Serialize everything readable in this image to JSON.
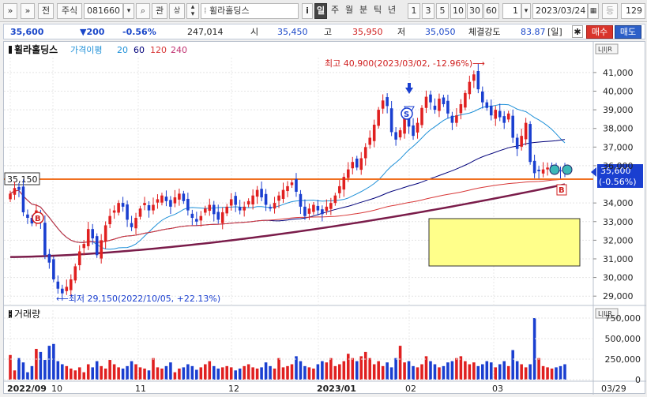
{
  "toolbar": {
    "expand_label": "»",
    "collapse_label": "»",
    "jeon_label": "전",
    "market_label": "주식",
    "code": "081660",
    "gwan_label": "관",
    "name": "휠라홀딩스",
    "info_label": "i",
    "periods": [
      "일",
      "주",
      "월",
      "분",
      "틱",
      "년"
    ],
    "active_period": "일",
    "minutes": [
      "1",
      "3",
      "5",
      "10",
      "30",
      "60"
    ],
    "count_value": "1",
    "date": "2023/03/24",
    "equal_label": "등",
    "bars": "129"
  },
  "quote": {
    "price": "35,600",
    "change": "▼200",
    "change_pct": "-0.56%",
    "volume": "247,014",
    "open_label": "시",
    "open": "35,450",
    "high_label": "고",
    "high": "35,950",
    "low_label": "저",
    "low": "35,050",
    "strength_label": "체결강도",
    "strength": "83.87",
    "period_tag": "[일]",
    "buy_label": "매수",
    "sell_label": "매도"
  },
  "chart": {
    "legend_title": "휠라홀딩스",
    "legend_ma_label": "가격이평",
    "ma_periods": [
      "20",
      "60",
      "120",
      "240"
    ],
    "ma_colors": [
      "#1e90d8",
      "#00007a",
      "#d83838",
      "#7a1c4a"
    ],
    "ohlc_button_label": "L|I|R",
    "hline_label": "35,150",
    "high_annotation": "최고 40,900(2023/03/02, -12.96%)⟶",
    "low_annotation": "⟵최저 29,150(2022/10/05, +22.13%)",
    "current_price_tag": "35,600",
    "current_pct_tag": "(-0.56%)",
    "marker_B": "B",
    "marker_S": "S",
    "volume_title": "거래량",
    "x_ticks": [
      "2022/09",
      "10",
      "11",
      "12",
      "2023/01",
      "02",
      "03",
      "03/29"
    ],
    "y_ticks": [
      "41,000",
      "40,000",
      "39,000",
      "38,000",
      "37,000",
      "36,000",
      "34,000",
      "33,000",
      "32,000",
      "31,000",
      "30,000",
      "29,000"
    ],
    "vol_ticks": [
      "750,000",
      "500,000",
      "250,000",
      "0"
    ]
  },
  "chart_data": {
    "type": "candlestick",
    "title": "휠라홀딩스",
    "y_range": [
      28500,
      41800
    ],
    "hline": 35150,
    "close_series": [
      34500,
      34800,
      34700,
      33500,
      33200,
      32900,
      33600,
      33000,
      31200,
      30800,
      29900,
      29400,
      29150,
      29500,
      29900,
      30600,
      31400,
      31800,
      32600,
      32100,
      31200,
      32000,
      32800,
      33300,
      33600,
      34000,
      33800,
      33100,
      32700,
      33200,
      33700,
      34000,
      33600,
      33900,
      34200,
      34400,
      34100,
      33800,
      34300,
      34500,
      34100,
      33600,
      33200,
      33000,
      33300,
      33700,
      33900,
      33400,
      33100,
      33500,
      33800,
      34200,
      33900,
      33600,
      33800,
      34100,
      34400,
      34700,
      34300,
      33900,
      33700,
      34000,
      34400,
      34700,
      34900,
      35100,
      34600,
      33800,
      33300,
      33700,
      33900,
      33600,
      33400,
      33800,
      34000,
      34400,
      34900,
      35400,
      35800,
      36200,
      35900,
      36400,
      37000,
      37500,
      38200,
      39000,
      39500,
      39200,
      37800,
      37400,
      37900,
      38600,
      38100,
      37600,
      38300,
      39100,
      39700,
      39400,
      39000,
      39600,
      39300,
      38800,
      38300,
      38700,
      39300,
      39900,
      40500,
      40900,
      40100,
      39400,
      39100,
      38700,
      39000,
      38600,
      38300,
      38800,
      37500,
      36900,
      37600,
      38300,
      36200,
      35600,
      35700,
      35800,
      35900,
      36000,
      35800,
      35700,
      35600
    ],
    "volume_series": [
      0.4,
      0.15,
      0.35,
      0.28,
      0.12,
      0.22,
      0.5,
      0.45,
      0.32,
      0.55,
      0.58,
      0.3,
      0.25,
      0.22,
      0.18,
      0.15,
      0.2,
      0.12,
      0.25,
      0.2,
      0.3,
      0.22,
      0.18,
      0.32,
      0.25,
      0.2,
      0.18,
      0.22,
      0.3,
      0.25,
      0.2,
      0.18,
      0.15,
      0.35,
      0.2,
      0.18,
      0.22,
      0.28,
      0.12,
      0.18,
      0.2,
      0.25,
      0.22,
      0.16,
      0.2,
      0.25,
      0.3,
      0.22,
      0.18,
      0.2,
      0.22,
      0.2,
      0.15,
      0.18,
      0.22,
      0.25,
      0.2,
      0.18,
      0.2,
      0.28,
      0.22,
      0.18,
      0.35,
      0.2,
      0.22,
      0.25,
      0.38,
      0.3,
      0.22,
      0.2,
      0.18,
      0.25,
      0.3,
      0.28,
      0.35,
      0.22,
      0.25,
      0.3,
      0.42,
      0.35,
      0.3,
      0.38,
      0.45,
      0.35,
      0.25,
      0.3,
      0.22,
      0.28,
      0.2,
      0.35,
      0.55,
      0.28,
      0.3,
      0.22,
      0.2,
      0.25,
      0.38,
      0.3,
      0.25,
      0.2,
      0.22,
      0.28,
      0.3,
      0.35,
      0.38,
      0.3,
      0.25,
      0.28,
      0.22,
      0.25,
      0.3,
      0.28,
      0.2,
      0.25,
      0.3,
      0.22,
      0.48,
      0.3,
      0.25,
      0.2,
      0.25,
      1.0,
      0.35,
      0.22,
      0.2,
      0.18,
      0.2,
      0.22,
      0.25
    ],
    "colors": {
      "up": "#e02020",
      "down": "#1a3fd0",
      "hline": "#f07020"
    }
  }
}
